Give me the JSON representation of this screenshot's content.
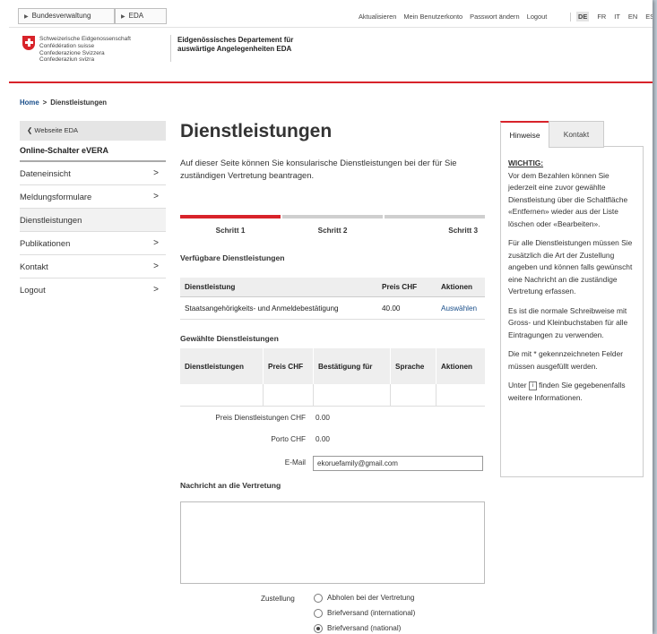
{
  "breadcrumb_top": {
    "items": [
      "Bundesverwaltung",
      "EDA"
    ]
  },
  "topnav": {
    "items": [
      "Aktualisieren",
      "Mein Benutzerkonto",
      "Passwort ändern",
      "Logout"
    ]
  },
  "languages": {
    "items": [
      "DE",
      "FR",
      "IT",
      "EN",
      "ES"
    ],
    "active": "DE"
  },
  "header": {
    "confederation": [
      "Schweizerische Eidgenossenschaft",
      "Confédération suisse",
      "Confederazione Svizzera",
      "Confederaziun svizra"
    ],
    "department": [
      "Eidgenössisches Departement für",
      "auswärtige Angelegenheiten EDA"
    ]
  },
  "breadcrumb": {
    "home": "Home",
    "separator": ">",
    "current": "Dienstleistungen"
  },
  "sidebar": {
    "back_label": "Webseite EDA",
    "head": "Online-Schalter eVERA",
    "items": [
      {
        "label": "Dateneinsicht",
        "chevron": ">"
      },
      {
        "label": "Meldungsformulare",
        "chevron": ">"
      },
      {
        "label": "Dienstleistungen",
        "chevron": ""
      },
      {
        "label": "Publikationen",
        "chevron": ">"
      },
      {
        "label": "Kontakt",
        "chevron": ">"
      },
      {
        "label": "Logout",
        "chevron": ">"
      }
    ]
  },
  "main": {
    "title": "Dienstleistungen",
    "intro": "Auf dieser Seite können Sie konsularische Dienstleistungen bei der für Sie zuständigen Vertretung beantragen.",
    "steps": [
      {
        "label": "Schritt 1",
        "active": true
      },
      {
        "label": "Schritt 2",
        "active": false
      },
      {
        "label": "Schritt 3",
        "active": false
      }
    ],
    "available": {
      "title": "Verfügbare Dienstleistungen",
      "headers": [
        "Dienstleistung",
        "Preis CHF",
        "Aktionen"
      ],
      "rows": [
        {
          "service": "Staatsangehörigkeits- und Anmeldebestätigung",
          "price": "40.00",
          "action": "Auswählen"
        }
      ]
    },
    "chosen": {
      "title": "Gewählte Dienstleistungen",
      "headers": [
        "Dienstleistungen",
        "Preis CHF",
        "Bestätigung für",
        "Sprache",
        "Aktionen"
      ]
    },
    "summary": {
      "price_label": "Preis Dienstleistungen CHF",
      "price_value": "0.00",
      "porto_label": "Porto CHF",
      "porto_value": "0.00",
      "email_label": "E-Mail",
      "email_value": "ekoruefamily@gmail.com"
    },
    "message": {
      "title": "Nachricht an die Vertretung",
      "value": ""
    },
    "delivery": {
      "label": "Zustellung",
      "options": [
        {
          "label": "Abholen bei der Vertretung",
          "selected": false
        },
        {
          "label": "Briefversand (international)",
          "selected": false
        },
        {
          "label": "Briefversand (national)",
          "selected": true
        }
      ]
    }
  },
  "panel": {
    "tabs": [
      "Hinweise",
      "Kontakt"
    ],
    "active_tab": "Hinweise",
    "warning_title": "WICHTIG:",
    "paragraphs": [
      "Vor dem Bezahlen können Sie jederzeit eine zuvor gewählte Dienstleistung über die Schaltfläche «Entfernen» wieder aus der Liste löschen oder «Bearbeiten».",
      "Für alle Dienstleistungen müssen Sie zusätzlich die Art der Zustellung angeben und können falls gewünscht eine Nachricht an die zuständige Vertretung erfassen.",
      "Es ist die normale Schreibweise mit Gross- und Kleinbuchstaben für alle Eintragungen zu verwenden.",
      "Die mit * gekennzeichneten Felder müssen ausgefüllt werden."
    ],
    "info_prefix": "Unter",
    "info_suffix": "finden Sie gegebenenfalls weitere Informationen."
  },
  "colors": {
    "accent": "#d8232a",
    "link": "#1a4f8b"
  }
}
